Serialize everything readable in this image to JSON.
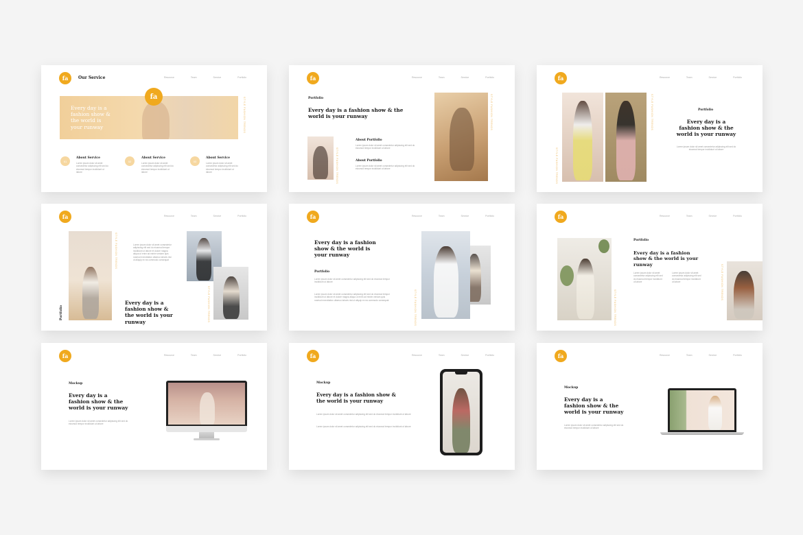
{
  "logo": "fa",
  "nav": [
    "Resource",
    "Team",
    "Service",
    "Portfolio"
  ],
  "headline": "Every day is a fashion show & the world is your runway",
  "vertical_text": "STYLE FASHION TRENDS",
  "para_short": "Lorem ipsum dolor sit amet consectetur adipiscing elit sed do eiusmod tempor incididunt ut labore",
  "para_long": "Lorem ipsum dolor sit amet consectetur adipiscing elit sed do eiusmod tempor incididunt ut labore et dolore magna aliqua ut enim ad minim veniam quis nostrud exercitation ullamco laboris nisi ut aliquip ex ea commodo consequat",
  "slide1": {
    "title": "Our Service",
    "banner_text": "Every day is a fashion show & the world is your runway",
    "services": [
      {
        "num": "01",
        "title": "About Service"
      },
      {
        "num": "02",
        "title": "About Service"
      },
      {
        "num": "03",
        "title": "About Service"
      }
    ]
  },
  "slide2": {
    "label": "Portfolio",
    "about1": "About Portfolio",
    "about2": "About Portfolio"
  },
  "slide3": {
    "label": "Portfolio"
  },
  "slide4": {
    "label": "Portfolio"
  },
  "slide5": {
    "label": "Portfolio"
  },
  "slide6": {
    "label": "Portfolio"
  },
  "slide7": {
    "label": "Mockup"
  },
  "slide8": {
    "label": "Mockup"
  },
  "slide9": {
    "label": "Mockup"
  },
  "colors": {
    "accent": "#f0a91e",
    "accent_soft": "#f6d7a0"
  }
}
